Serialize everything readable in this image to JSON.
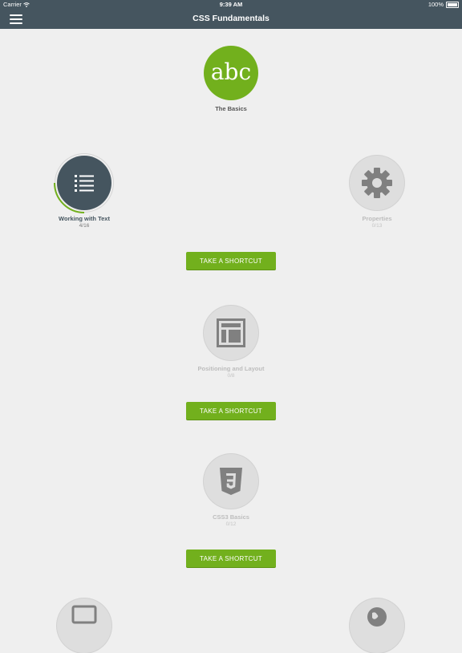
{
  "status_bar": {
    "carrier": "Carrier",
    "wifi_icon": "wifi-icon",
    "time": "9:39 AM",
    "battery_percent": "100%"
  },
  "nav_bar": {
    "title": "CSS Fundamentals",
    "menu_icon": "hamburger-menu-icon"
  },
  "colors": {
    "nav_background": "#45555f",
    "accent_green": "#72b01d",
    "locked_gray": "#dedede",
    "page_background": "#efefef"
  },
  "lessons": {
    "basics": {
      "icon_text": "abc",
      "label": "The Basics",
      "status": "completed"
    },
    "text": {
      "label": "Working with Text",
      "progress": "4/16",
      "progress_fraction": 0.25,
      "icon": "list-icon",
      "status": "in-progress"
    },
    "properties": {
      "label": "Properties",
      "progress": "0/13",
      "icon": "gear-icon",
      "status": "locked"
    },
    "layout": {
      "label": "Positioning and Layout",
      "progress": "0/8",
      "icon": "layout-icon",
      "status": "locked"
    },
    "css3": {
      "label": "CSS3 Basics",
      "progress": "0/12",
      "icon": "css3-shield-icon",
      "status": "locked"
    },
    "bottom_left": {
      "icon": "monitor-icon",
      "status": "locked"
    },
    "bottom_right": {
      "icon": "globe-icon",
      "status": "locked"
    }
  },
  "shortcuts": {
    "first": "TAKE A SHORTCUT",
    "second": "TAKE A SHORTCUT",
    "third": "TAKE A SHORTCUT"
  }
}
